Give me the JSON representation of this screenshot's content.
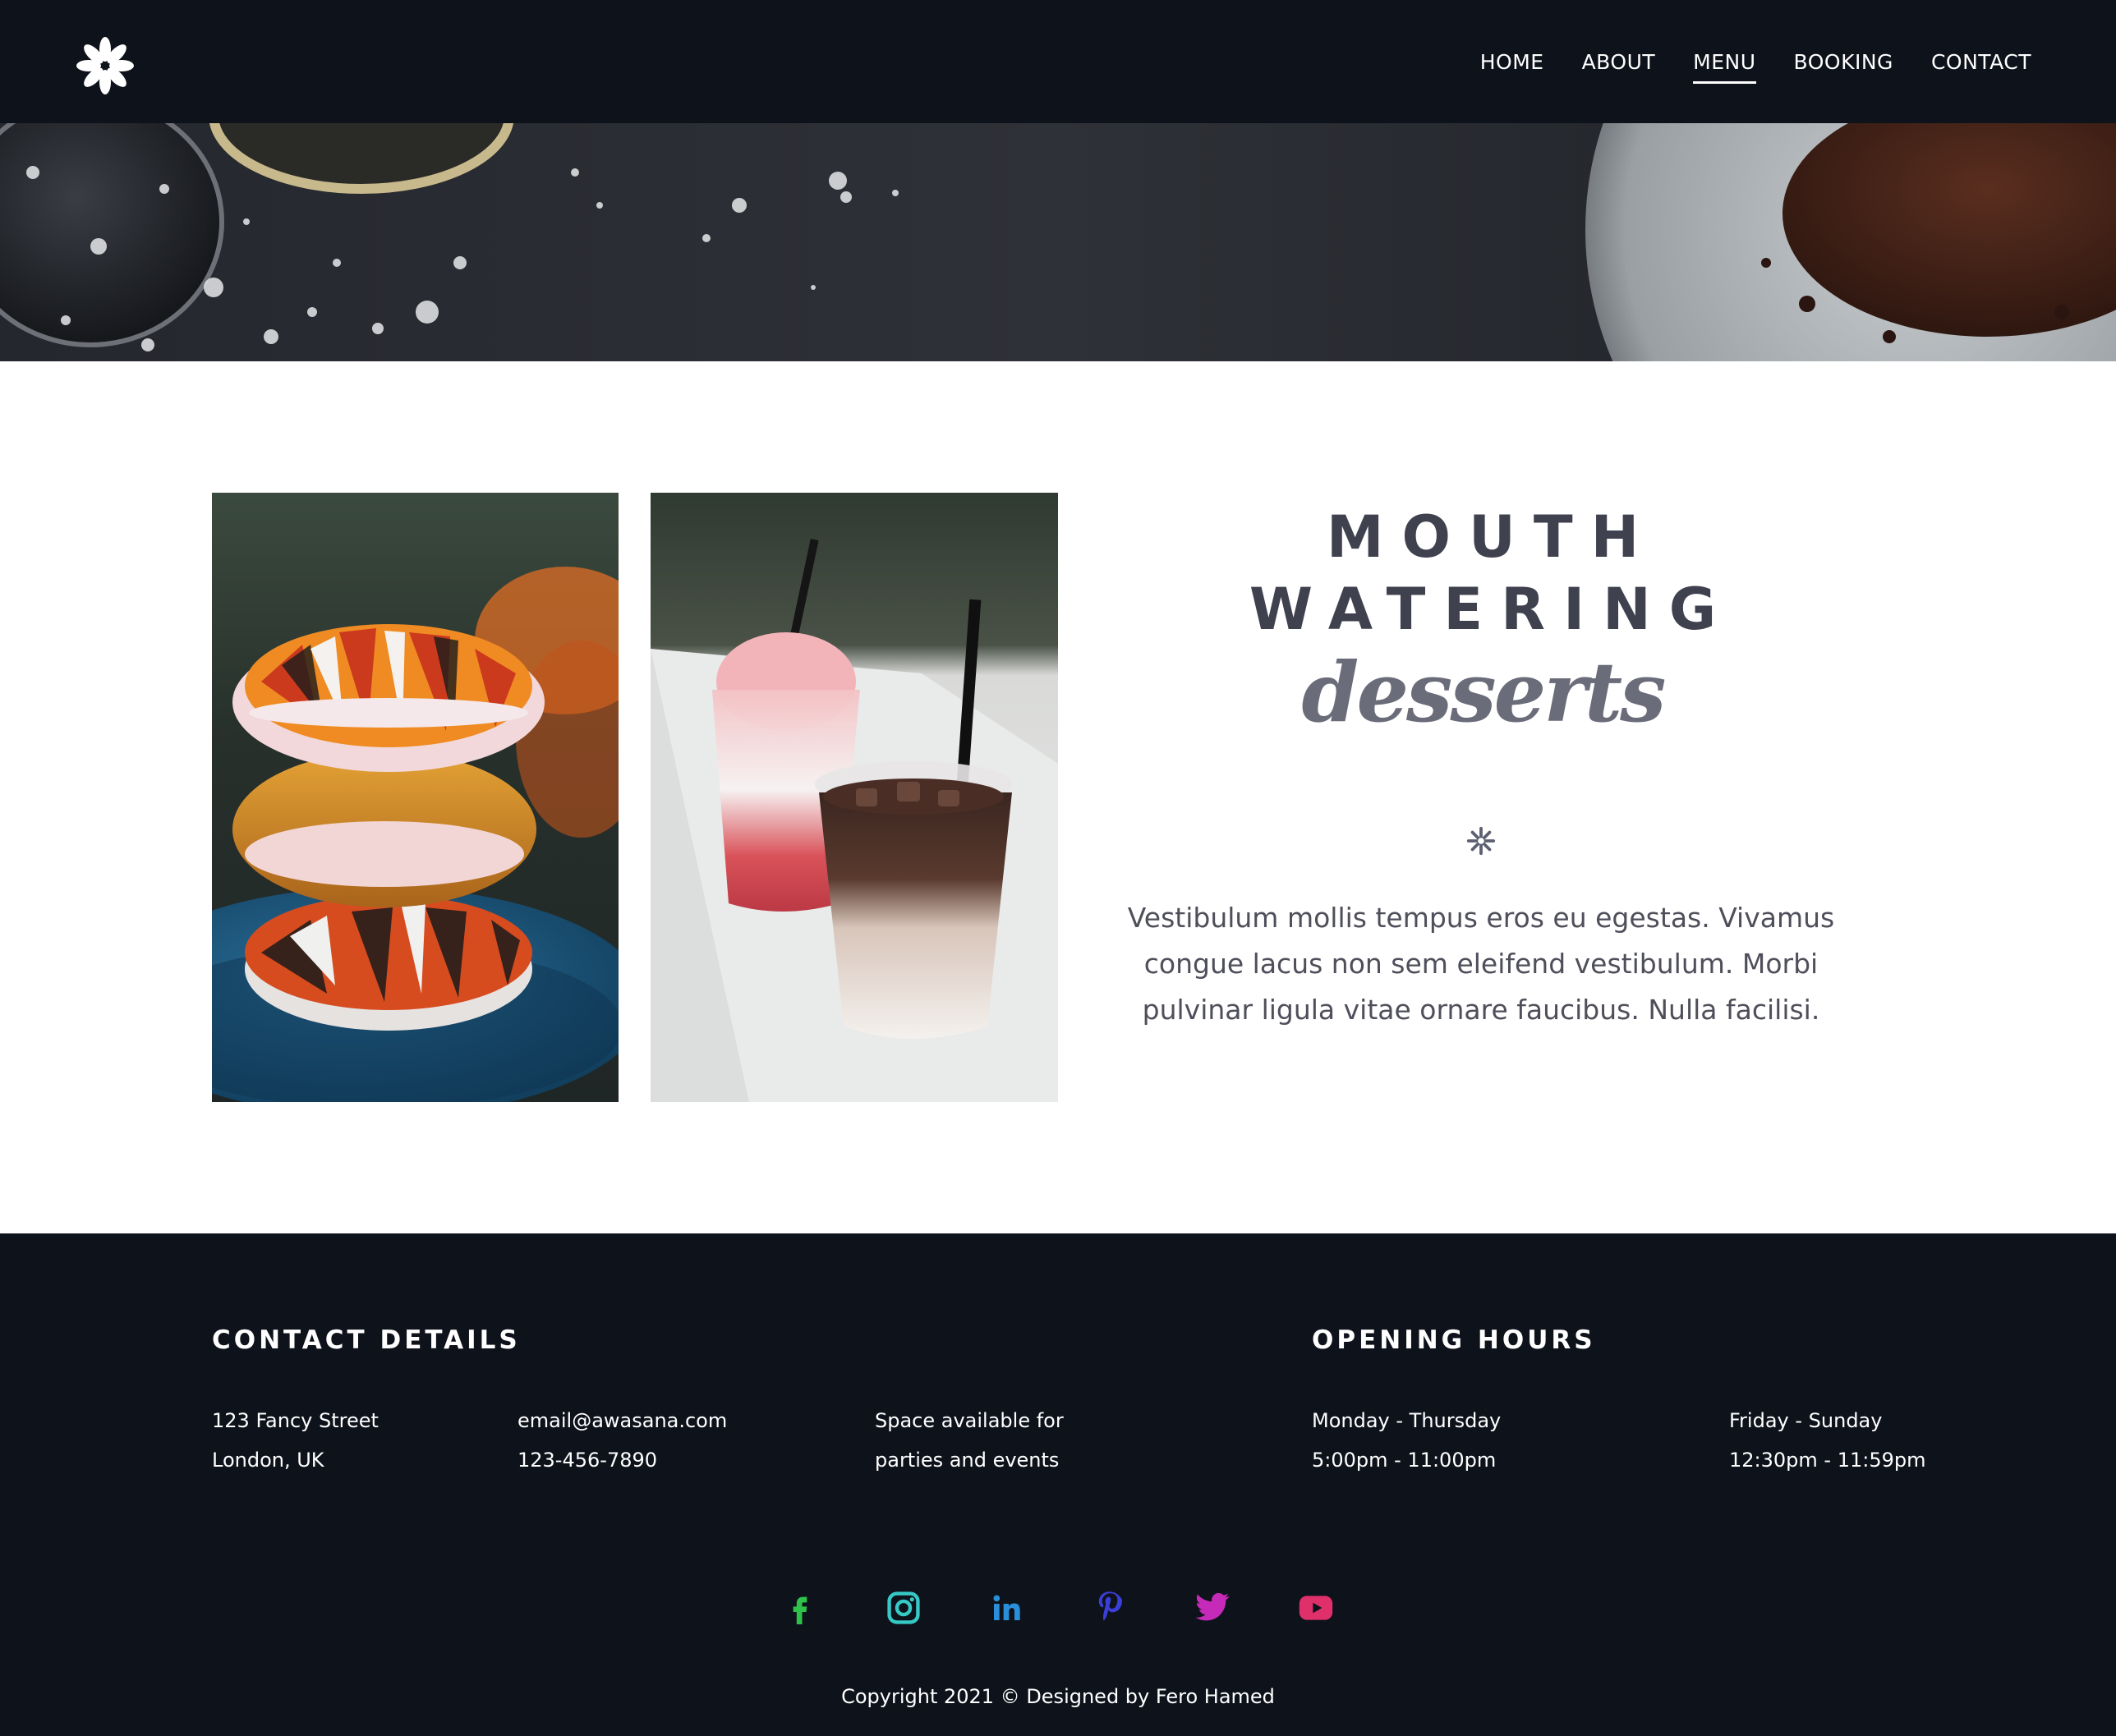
{
  "nav": {
    "logo_icon": "asterisk-flower-icon",
    "items": [
      {
        "label": "HOME",
        "active": false
      },
      {
        "label": "ABOUT",
        "active": false
      },
      {
        "label": "MENU",
        "active": true
      },
      {
        "label": "BOOKING",
        "active": false
      },
      {
        "label": "CONTACT",
        "active": false
      }
    ]
  },
  "hero": {
    "image": "dark-table-with-cocoa-powder"
  },
  "feature": {
    "images": [
      "stacked-donuts-photo",
      "iced-drinks-photo"
    ],
    "title_line1": "MOUTH",
    "title_line2": "WATERING",
    "title_script": "desserts",
    "divider_icon": "asterisk-icon",
    "description": "Vestibulum mollis tempus eros eu egestas. Vivamus congue lacus non sem eleifend vestibulum. Morbi pulvinar ligula vitae ornare faucibus. Nulla facilisi."
  },
  "footer": {
    "contact_heading": "CONTACT DETAILS",
    "address_line1": "123 Fancy Street",
    "address_line2": "London, UK",
    "email": "email@awasana.com",
    "phone": "123-456-7890",
    "space_line1": "Space available for",
    "space_line2": "parties and events",
    "hours_heading": "OPENING HOURS",
    "weekday_label": "Monday - Thursday",
    "weekday_hours": "5:00pm - 11:00pm",
    "weekend_label": "Friday - Sunday",
    "weekend_hours": "12:30pm - 11:59pm",
    "socials": [
      {
        "icon": "facebook-icon",
        "color": "#2fc24a"
      },
      {
        "icon": "instagram-icon",
        "color": "#36c9c6"
      },
      {
        "icon": "linkedin-icon",
        "color": "#2a8fd8"
      },
      {
        "icon": "pinterest-icon",
        "color": "#3b3fd9"
      },
      {
        "icon": "twitter-icon",
        "color": "#c62ab8"
      },
      {
        "icon": "youtube-icon",
        "color": "#e0306b"
      }
    ],
    "copyright": "Copyright 2021 © Designed by Fero Hamed"
  },
  "colors": {
    "nav_bg": "#0e121b",
    "footer_bg": "#0e121b",
    "title_color": "#3f414f",
    "script_color": "#6b6c7a"
  }
}
